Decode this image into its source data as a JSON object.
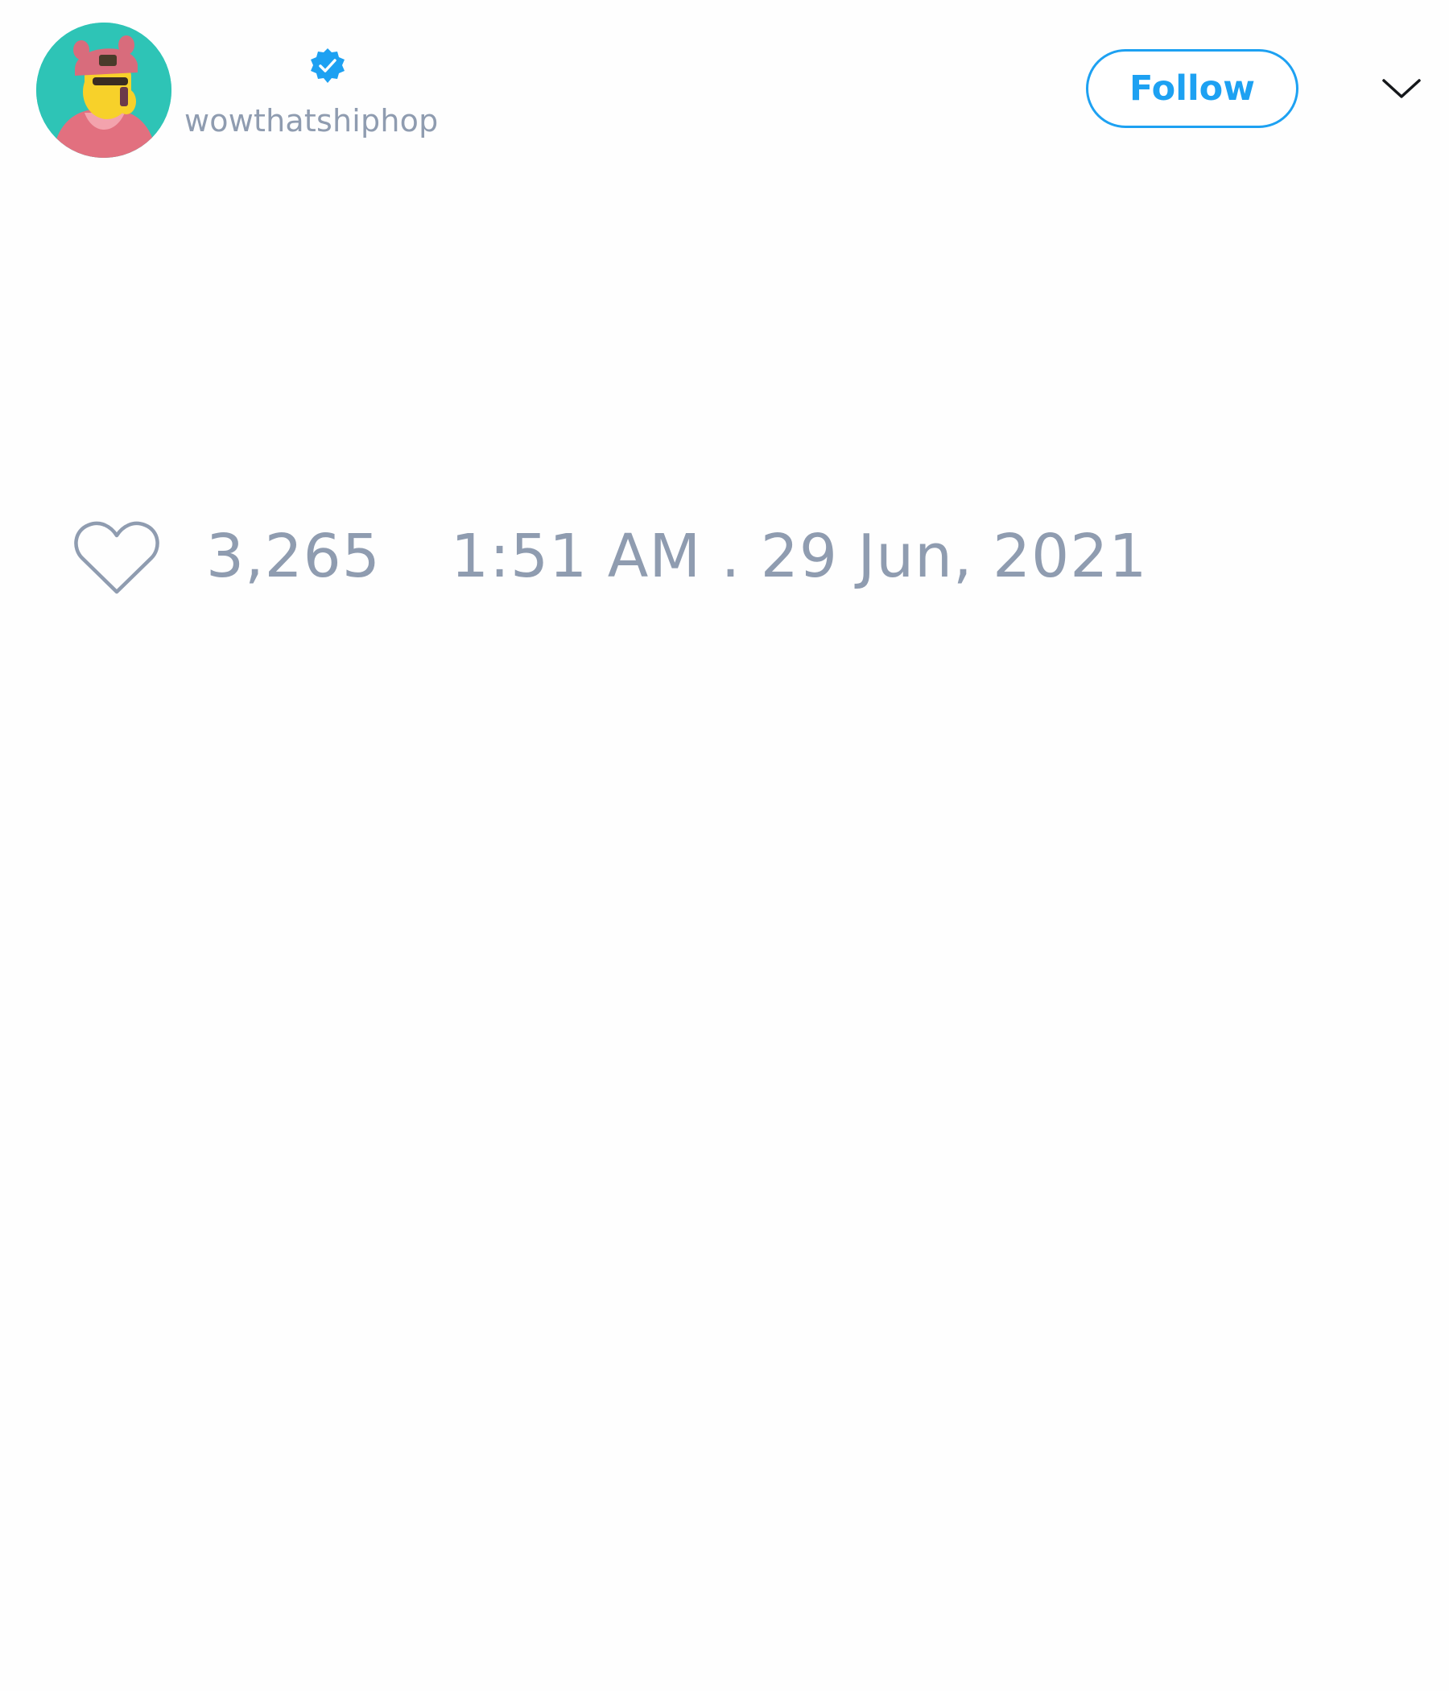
{
  "header": {
    "display_name": "",
    "handle": "wowthatshiphop",
    "verified_icon": "verified-badge-icon",
    "follow_label": "Follow",
    "menu_icon": "chevron-down-icon"
  },
  "tweet": {
    "like_icon": "heart-icon",
    "like_count": "3,265",
    "timestamp": "1:51 AM . 29 Jun, 2021"
  },
  "colors": {
    "accent": "#1da1f2",
    "muted_text": "#8f9cb0",
    "avatar_bg": "#2ec4b6"
  }
}
